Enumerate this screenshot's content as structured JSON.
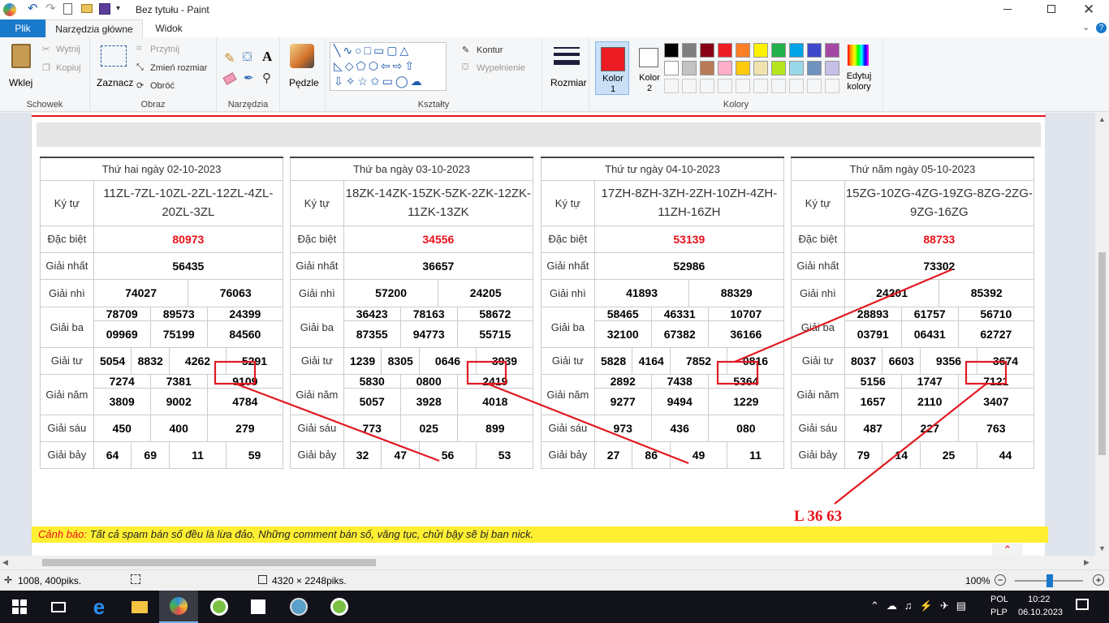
{
  "window": {
    "title": "Bez tytułu - Paint"
  },
  "tabs": {
    "file": "Plik",
    "home": "Narzędzia główne",
    "view": "Widok"
  },
  "clipboard": {
    "paste": "Wklej",
    "cut": "Wytnij",
    "copy": "Kopiuj",
    "label": "Schowek"
  },
  "image": {
    "select": "Zaznacz",
    "crop": "Przytnij",
    "resize": "Zmień rozmiar",
    "rotate": "Obróć",
    "label": "Obraz"
  },
  "tools": {
    "label": "Narzędzia"
  },
  "brushes": {
    "label": "Pędzle"
  },
  "shapes": {
    "outline": "Kontur",
    "fill": "Wypełnienie",
    "label": "Kształty"
  },
  "size": {
    "label": "Rozmiar"
  },
  "colors": {
    "color1": "Kolor 1",
    "color2": "Kolor 2",
    "edit": "Edytuj kolory",
    "label": "Kolory",
    "color1_value": "#ed1c24",
    "color2_value": "#ffffff",
    "palette": [
      "#000000",
      "#7f7f7f",
      "#880015",
      "#ed1c24",
      "#ff7f27",
      "#fff200",
      "#22b14c",
      "#00a2e8",
      "#3f48cc",
      "#a349a4",
      "#ffffff",
      "#c3c3c3",
      "#b97a57",
      "#ffaec9",
      "#ffc90e",
      "#efe4b0",
      "#b5e61d",
      "#99d9ea",
      "#7092be",
      "#c8bfe7"
    ]
  },
  "results": [
    {
      "header": "Thứ hai ngày 02-10-2023",
      "kytu_label": "Ký tự",
      "kytu": "11ZL-7ZL-10ZL-2ZL-12ZL-4ZL-20ZL-3ZL",
      "db_label": "Đặc biệt",
      "db": "80973",
      "g1_label": "Giải nhất",
      "g1": "56435",
      "g2_label": "Giải nhì",
      "g2": [
        "74027",
        "76063"
      ],
      "g3_label": "Giải ba",
      "g3": [
        "78709",
        "89573",
        "24399",
        "09969",
        "75199",
        "84560"
      ],
      "g4_label": "Giải tư",
      "g4": [
        "5054",
        "8832",
        "4262",
        "5291"
      ],
      "g5_label": "Giải năm",
      "g5": [
        "7274",
        "7381",
        "9109",
        "3809",
        "9002",
        "4784"
      ],
      "g6_label": "Giải sáu",
      "g6": [
        "450",
        "400",
        "279"
      ],
      "g7_label": "Giải bảy",
      "g7": [
        "64",
        "69",
        "11",
        "59"
      ]
    },
    {
      "header": "Thứ ba ngày 03-10-2023",
      "kytu_label": "Ký tự",
      "kytu": "18ZK-14ZK-15ZK-5ZK-2ZK-12ZK-11ZK-13ZK",
      "db_label": "Đặc biệt",
      "db": "34556",
      "g1_label": "Giải nhất",
      "g1": "36657",
      "g2_label": "Giải nhì",
      "g2": [
        "57200",
        "24205"
      ],
      "g3_label": "Giải ba",
      "g3": [
        "36423",
        "78163",
        "58672",
        "87355",
        "94773",
        "55715"
      ],
      "g4_label": "Giải tư",
      "g4": [
        "1239",
        "8305",
        "0646",
        "3939"
      ],
      "g5_label": "Giải năm",
      "g5": [
        "5830",
        "0800",
        "2419",
        "5057",
        "3928",
        "4018"
      ],
      "g6_label": "Giải sáu",
      "g6": [
        "773",
        "025",
        "899"
      ],
      "g7_label": "Giải bảy",
      "g7": [
        "32",
        "47",
        "56",
        "53"
      ]
    },
    {
      "header": "Thứ tư ngày 04-10-2023",
      "kytu_label": "Ký tự",
      "kytu": "17ZH-8ZH-3ZH-2ZH-10ZH-4ZH-11ZH-16ZH",
      "db_label": "Đặc biệt",
      "db": "53139",
      "g1_label": "Giải nhất",
      "g1": "52986",
      "g2_label": "Giải nhì",
      "g2": [
        "41893",
        "88329"
      ],
      "g3_label": "Giải ba",
      "g3": [
        "58465",
        "46331",
        "10707",
        "32100",
        "67382",
        "36166"
      ],
      "g4_label": "Giải tư",
      "g4": [
        "5828",
        "4164",
        "7852",
        "0816"
      ],
      "g5_label": "Giải năm",
      "g5": [
        "2892",
        "7438",
        "5364",
        "9277",
        "9494",
        "1229"
      ],
      "g6_label": "Giải sáu",
      "g6": [
        "973",
        "436",
        "080"
      ],
      "g7_label": "Giải bảy",
      "g7": [
        "27",
        "86",
        "49",
        "11"
      ]
    },
    {
      "header": "Thứ năm ngày 05-10-2023",
      "kytu_label": "Ký tự",
      "kytu": "15ZG-10ZG-4ZG-19ZG-8ZG-2ZG-9ZG-16ZG",
      "db_label": "Đặc biệt",
      "db": "88733",
      "g1_label": "Giải nhất",
      "g1": "73302",
      "g2_label": "Giải nhì",
      "g2": [
        "24201",
        "85392"
      ],
      "g3_label": "Giải ba",
      "g3": [
        "28893",
        "61757",
        "56710",
        "03791",
        "06431",
        "62727"
      ],
      "g4_label": "Giải tư",
      "g4": [
        "8037",
        "6603",
        "9356",
        "3674"
      ],
      "g5_label": "Giải năm",
      "g5": [
        "5156",
        "1747",
        "7121",
        "1657",
        "2110",
        "3407"
      ],
      "g6_label": "Giải sáu",
      "g6": [
        "487",
        "227",
        "763"
      ],
      "g7_label": "Giải bảy",
      "g7": [
        "79",
        "14",
        "25",
        "44"
      ]
    }
  ],
  "annotation": "L 36 63",
  "warning": {
    "prefix": "Cảnh báo:",
    "text": " Tất cả spam bán số đều là lừa đảo. Những comment bán số, văng tục, chửi bậy sẽ bị ban nick."
  },
  "statusbar": {
    "cursor": "1008, 400piks.",
    "dimensions": "4320 × 2248piks.",
    "zoom": "100%"
  },
  "taskbar": {
    "lang1": "POL",
    "lang2": "PLP",
    "time": "10:22",
    "date": "06.10.2023"
  }
}
